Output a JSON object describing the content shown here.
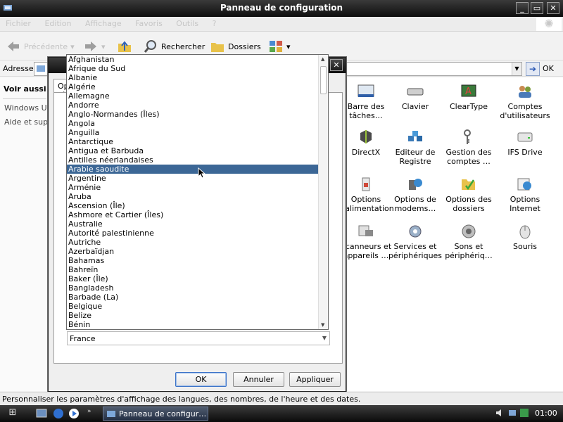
{
  "window": {
    "title": "Panneau de configuration",
    "minimize": "_",
    "maximize": "▭",
    "close": "✕"
  },
  "menubar": {
    "items": [
      "Fichier",
      "Edition",
      "Affichage",
      "Favoris",
      "Outils",
      "?"
    ]
  },
  "toolbar": {
    "back_label": "Précédente",
    "search_label": "Rechercher",
    "folders_label": "Dossiers"
  },
  "addressbar": {
    "label": "Adresse",
    "value": "",
    "go_label": "OK"
  },
  "leftpane": {
    "heading": "Voir aussi",
    "links": [
      "Windows Update",
      "Aide et support"
    ]
  },
  "icons": [
    {
      "label": "Barre des tâches…",
      "icon": "taskbar-icon"
    },
    {
      "label": "Clavier",
      "icon": "keyboard-icon"
    },
    {
      "label": "ClearType",
      "icon": "cleartype-icon"
    },
    {
      "label": "Comptes d'utilisateurs",
      "icon": "users-icon"
    },
    {
      "label": "DirectX",
      "icon": "directx-icon"
    },
    {
      "label": "Editeur de Registre",
      "icon": "registry-icon"
    },
    {
      "label": "Gestion des comptes …",
      "icon": "keys-icon"
    },
    {
      "label": "IFS Drive",
      "icon": "drive-icon"
    },
    {
      "label": "Options d'alimentation",
      "icon": "power-icon"
    },
    {
      "label": "Options de modems…",
      "icon": "phone-modem-icon"
    },
    {
      "label": "Options des dossiers",
      "icon": "folder-options-icon"
    },
    {
      "label": "Options Internet",
      "icon": "internet-options-icon"
    },
    {
      "label": "Scanneurs et appareils …",
      "icon": "scanner-icon"
    },
    {
      "label": "Services et périphériques",
      "icon": "gear-icon"
    },
    {
      "label": "Sons et périphériq…",
      "icon": "sound-icon"
    },
    {
      "label": "Souris",
      "icon": "mouse-icon"
    }
  ],
  "dialog": {
    "tab_label": "Options régionales",
    "selected_country": "France",
    "ok_label": "OK",
    "cancel_label": "Annuler",
    "apply_label": "Appliquer",
    "close": "✕"
  },
  "countries": {
    "items": [
      "Afghanistan",
      "Afrique du Sud",
      "Albanie",
      "Algérie",
      "Allemagne",
      "Andorre",
      "Anglo-Normandes (Îles)",
      "Angola",
      "Anguilla",
      "Antarctique",
      "Antigua et Barbuda",
      "Antilles néerlandaises",
      "Arabie saoudite",
      "Argentine",
      "Arménie",
      "Aruba",
      "Ascension (Île)",
      "Ashmore et Cartier (Îles)",
      "Australie",
      "Autorité palestinienne",
      "Autriche",
      "Azerbaïdjan",
      "Bahamas",
      "Bahreïn",
      "Baker (Île)",
      "Bangladesh",
      "Barbade (La)",
      "Belgique",
      "Belize",
      "Bénin"
    ],
    "highlighted": "Arabie saoudite"
  },
  "statusbar": {
    "text": "Personnaliser les paramètres d'affichage des langues, des nombres, de l'heure et des dates."
  },
  "taskbar": {
    "task_label": "Panneau de configur…",
    "clock": "01:00"
  }
}
